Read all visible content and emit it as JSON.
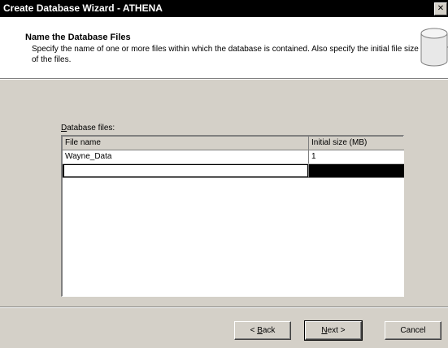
{
  "window": {
    "title": "Create Database Wizard - ATHENA",
    "close_glyph": "✕"
  },
  "header": {
    "title": "Name the Database Files",
    "subtitle": "Specify the name of one or more files within which the database is contained.  Also specify the initial file size for each of the files."
  },
  "files": {
    "label_accel": "D",
    "label_rest": "atabase files:",
    "columns": [
      "File name",
      "Initial size (MB)"
    ],
    "rows": [
      {
        "name": "Wayne_Data",
        "size": "1"
      },
      {
        "name": "",
        "size": ""
      }
    ]
  },
  "buttons": {
    "back_prefix": "< ",
    "back_accel": "B",
    "back_rest": "ack",
    "next_accel": "N",
    "next_rest": "ext >",
    "cancel": "Cancel"
  },
  "icons": {
    "database": "database-cylinder-icon",
    "close": "close-icon"
  }
}
